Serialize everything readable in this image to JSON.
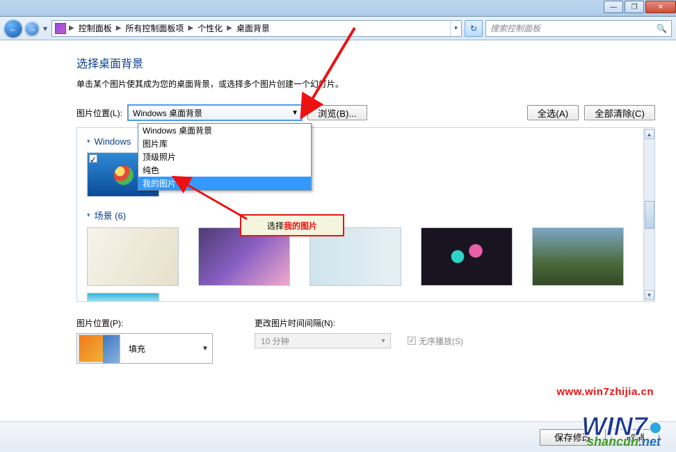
{
  "window": {
    "min_icon": "—",
    "max_icon": "❐",
    "close_icon": "✕"
  },
  "addr": {
    "back_glyph": "←",
    "fwd_glyph": "→",
    "dropdown_glyph": "▾",
    "refresh_glyph": "↻",
    "crumb1": "控制面板",
    "crumb2": "所有控制面板项",
    "crumb3": "个性化",
    "crumb4": "桌面背景",
    "crumb_sep": "▶",
    "search_placeholder": "搜索控制面板"
  },
  "page": {
    "title": "选择桌面背景",
    "desc": "单击某个图片使其成为您的桌面背景，或选择多个图片创建一个幻灯片。",
    "loc_label": "图片位置(L):",
    "combo_value": "Windows 桌面背景",
    "browse_btn": "浏览(B)...",
    "select_all_btn": "全选(A)",
    "clear_all_btn": "全部清除(C)"
  },
  "dropdown_options": [
    {
      "label": "Windows 桌面背景",
      "selected": false
    },
    {
      "label": "图片库",
      "selected": false
    },
    {
      "label": "顶级照片",
      "selected": false
    },
    {
      "label": "纯色",
      "selected": false
    },
    {
      "label": "我的图片",
      "selected": true
    }
  ],
  "groups": {
    "windows": {
      "label": "Windows",
      "count": ""
    },
    "scene": {
      "label": "场景 (6)"
    }
  },
  "lower": {
    "pos_label": "图片位置(P):",
    "pos_value": "填充",
    "interval_label": "更改图片时间间隔(N):",
    "interval_value": "10 分钟",
    "shuffle_label": "无序播放(S)"
  },
  "footer": {
    "save": "保存修改",
    "cancel": "取消"
  },
  "annot": {
    "tip_prefix": "选择",
    "tip_strong": "我的图片"
  },
  "watermark": {
    "url1": "www.win7zhijia.cn",
    "logo_main": "WIN7",
    "logo_dot": "●",
    "url2": "shancun",
    "url2_sfx": ".net"
  }
}
